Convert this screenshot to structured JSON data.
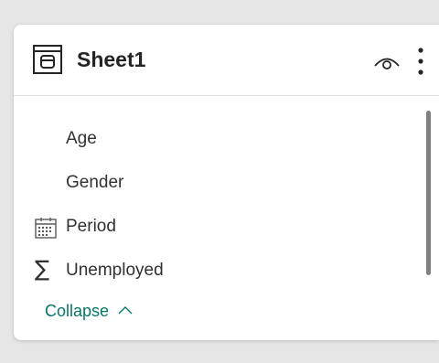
{
  "table": {
    "title": "Sheet1",
    "icon": "table-icon",
    "fields": [
      {
        "label": "Age",
        "icon": ""
      },
      {
        "label": "Gender",
        "icon": ""
      },
      {
        "label": "Period",
        "icon": "calendar-icon"
      },
      {
        "label": "Unemployed",
        "icon": "sigma-icon"
      }
    ],
    "collapse_label": "Collapse"
  },
  "colors": {
    "accent": "#077568",
    "text": "#252423",
    "border": "#e1e1e1"
  }
}
